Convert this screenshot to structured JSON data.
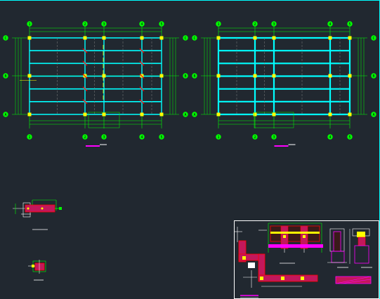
{
  "app": {
    "background": "#212830",
    "accent_border": "#00ffff"
  },
  "colors": {
    "grid": "#00ff00",
    "beam": "#00ffff",
    "column": "#ffff00",
    "rebar": "#ff0000",
    "dim": "#00ff00",
    "title_mark": "#ff00ff",
    "dashed": "#808080",
    "white": "#ffffff"
  },
  "plan_left": {
    "top_axes": [
      "1",
      "2",
      "3",
      "4",
      "5"
    ],
    "bottom_axes": [
      "1",
      "2",
      "3",
      "4",
      "5"
    ],
    "side_axes": [
      "C",
      "B",
      "A"
    ]
  },
  "plan_right": {
    "top_axes": [
      "1",
      "2",
      "3",
      "4",
      "5"
    ],
    "bottom_axes": [
      "1",
      "2",
      "3",
      "4",
      "5"
    ],
    "side_axes": [
      "C",
      "B",
      "A"
    ]
  },
  "icons": {
    "axis_bubble": "axis-bubble-icon",
    "column": "column-icon"
  }
}
